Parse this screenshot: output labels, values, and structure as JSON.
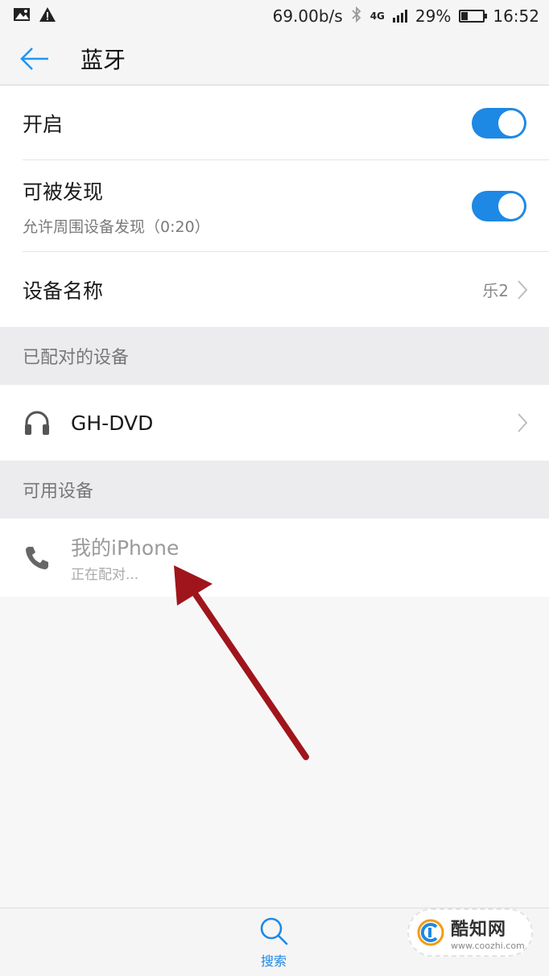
{
  "status_bar": {
    "speed": "69.00b/s",
    "network": "4G",
    "battery_percent": "29%",
    "battery_level": 0.29,
    "time": "16:52",
    "icons": [
      "image-icon",
      "warning-icon",
      "bluetooth-icon",
      "signal-icon",
      "battery-icon"
    ]
  },
  "header": {
    "title": "蓝牙",
    "back_icon": "arrow-left-icon"
  },
  "settings": {
    "enable": {
      "label": "开启",
      "on": true
    },
    "discoverable": {
      "label": "可被发现",
      "sublabel": "允许周围设备发现（0:20）",
      "on": true
    },
    "device_name": {
      "label": "设备名称",
      "value": "乐2"
    }
  },
  "paired_section": {
    "header": "已配对的设备",
    "devices": [
      {
        "name": "GH-DVD",
        "icon": "headphones-icon"
      }
    ]
  },
  "available_section": {
    "header": "可用设备",
    "devices": [
      {
        "name": "我的iPhone",
        "status": "正在配对...",
        "icon": "phone-icon"
      }
    ]
  },
  "bottom_bar": {
    "search_label": "搜索",
    "search_icon": "search-icon"
  },
  "watermark": {
    "title": "酷知网",
    "url": "www.coozhi.com"
  },
  "colors": {
    "accent": "#1e88e5",
    "annotation_arrow": "#a0151c"
  }
}
